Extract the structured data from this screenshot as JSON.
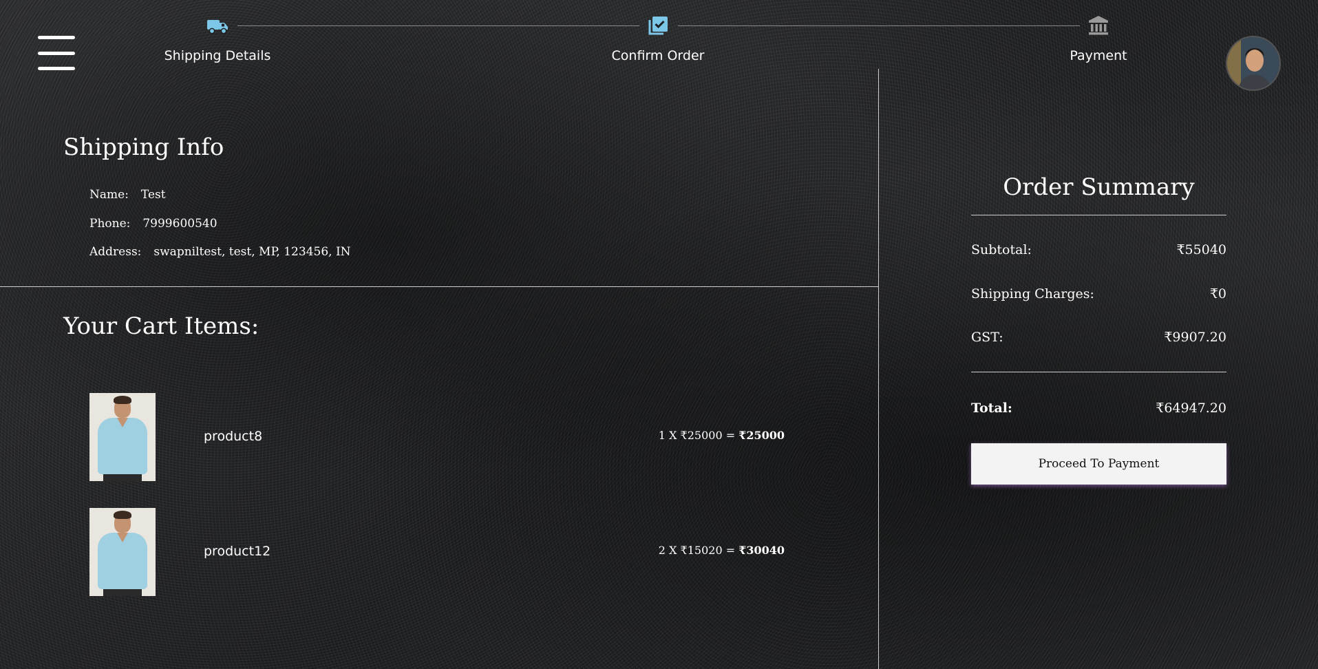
{
  "stepper": {
    "steps": [
      {
        "label": "Shipping Details",
        "icon": "truck-icon"
      },
      {
        "label": "Confirm Order",
        "icon": "checklist-icon"
      },
      {
        "label": "Payment",
        "icon": "bank-icon"
      }
    ],
    "active_color": "#7cc7e8",
    "inactive_color": "#9a9a9a"
  },
  "shipping_info": {
    "title": "Shipping Info",
    "name_label": "Name:",
    "name_value": "Test",
    "phone_label": "Phone:",
    "phone_value": "7999600540",
    "address_label": "Address:",
    "address_value": "swapniltest, test, MP, 123456, IN"
  },
  "cart": {
    "title": "Your Cart Items:",
    "items": [
      {
        "name": "product8",
        "qty_price": "1 X ₹25000 =",
        "total": "₹25000"
      },
      {
        "name": "product12",
        "qty_price": "2 X ₹15020 =",
        "total": "₹30040"
      }
    ]
  },
  "summary": {
    "title": "Order Summary",
    "subtotal_label": "Subtotal:",
    "subtotal_value": "₹55040",
    "shipping_label": "Shipping Charges:",
    "shipping_value": "₹0",
    "gst_label": "GST:",
    "gst_value": "₹9907.20",
    "total_label": "Total:",
    "total_value": "₹64947.20",
    "button_label": "Proceed To Payment"
  }
}
